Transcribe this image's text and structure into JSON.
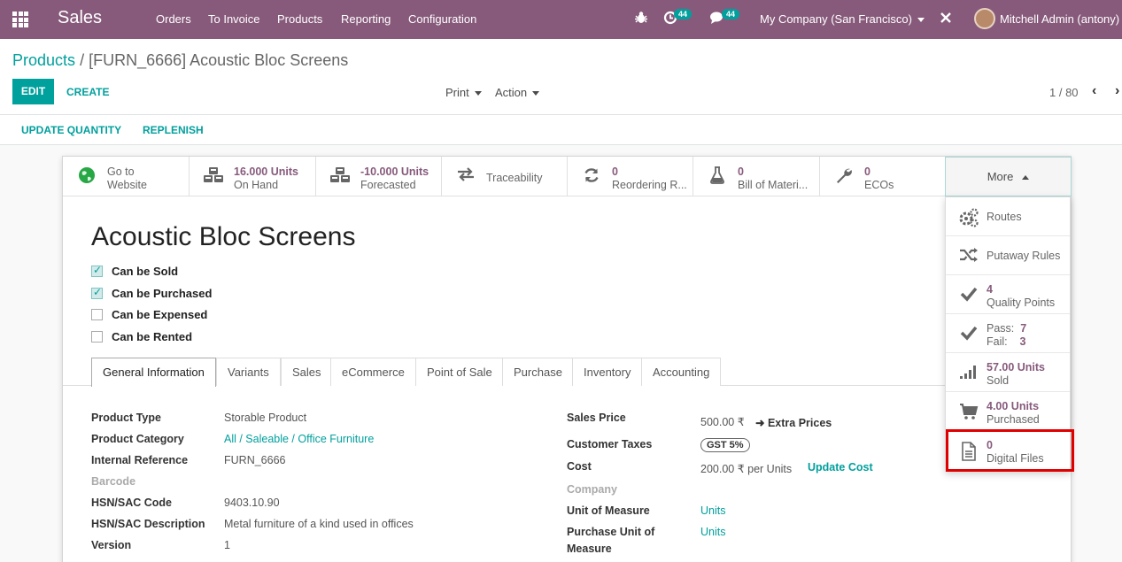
{
  "navbar": {
    "app_name": "Sales",
    "menu": [
      "Orders",
      "To Invoice",
      "Products",
      "Reporting",
      "Configuration"
    ],
    "activity_count": "44",
    "messages_count": "44",
    "company": "My Company (San Francisco)",
    "user": "Mitchell Admin (antony)"
  },
  "breadcrumb": {
    "parent": "Products",
    "separator": "/",
    "current": "[FURN_6666] Acoustic Bloc Screens"
  },
  "control": {
    "edit": "EDIT",
    "create": "CREATE",
    "print": "Print",
    "action": "Action",
    "pager": "1 / 80"
  },
  "header_buttons": {
    "update_quantity": "UPDATE QUANTITY",
    "replenish": "REPLENISH"
  },
  "smart_buttons": [
    {
      "line1": "Go to",
      "line2": "Website"
    },
    {
      "line1": "16.000 Units",
      "line2": "On Hand"
    },
    {
      "line1": "-10.000 Units",
      "line2": "Forecasted"
    },
    {
      "label": "Traceability"
    },
    {
      "line1": "0",
      "line2": "Reordering R..."
    },
    {
      "line1": "0",
      "line2": "Bill of Materi..."
    },
    {
      "line1": "0",
      "line2": "ECOs"
    }
  ],
  "more_label": "More",
  "more_menu": [
    {
      "label": "Routes"
    },
    {
      "label": "Putaway Rules"
    },
    {
      "line1": "4",
      "line2": "Quality Points"
    },
    {
      "pass_label": "Pass:",
      "pass_value": "7",
      "fail_label": "Fail:",
      "fail_value": "3"
    },
    {
      "line1": "57.00 Units",
      "line2": "Sold"
    },
    {
      "line1": "4.00 Units",
      "line2": "Purchased"
    },
    {
      "line1": "0",
      "line2": "Digital Files"
    }
  ],
  "product": {
    "name": "Acoustic Bloc Screens",
    "flags": [
      {
        "label": "Can be Sold",
        "checked": true
      },
      {
        "label": "Can be Purchased",
        "checked": true
      },
      {
        "label": "Can be Expensed",
        "checked": false
      },
      {
        "label": "Can be Rented",
        "checked": false
      }
    ]
  },
  "tabs": [
    "General Information",
    "Variants",
    "Sales",
    "eCommerce",
    "Point of Sale",
    "Purchase",
    "Inventory",
    "Accounting"
  ],
  "left_fields": [
    {
      "label": "Product Type",
      "value": "Storable Product"
    },
    {
      "label": "Product Category",
      "value": "All / Saleable / Office Furniture"
    },
    {
      "label": "Internal Reference",
      "value": "FURN_6666"
    },
    {
      "label": "Barcode",
      "value": ""
    },
    {
      "label": "HSN/SAC Code",
      "value": "9403.10.90"
    },
    {
      "label": "HSN/SAC Description",
      "value": "Metal furniture of a kind used in offices"
    },
    {
      "label": "Version",
      "value": "1"
    }
  ],
  "right_fields": {
    "sales_price_label": "Sales Price",
    "sales_price": "500.00 ₹",
    "extra_prices": "Extra Prices",
    "customer_taxes_label": "Customer Taxes",
    "customer_taxes": "GST 5%",
    "cost_label": "Cost",
    "cost": "200.00 ₹ per Units",
    "update_cost": "Update Cost",
    "company_label": "Company",
    "uom_label": "Unit of Measure",
    "uom": "Units",
    "puom_label_1": "Purchase Unit of",
    "puom_label_2": "Measure",
    "puom": "Units"
  },
  "colors": {
    "brand": "#875a7b",
    "accent": "#00a09d",
    "highlight": "#e00000"
  }
}
